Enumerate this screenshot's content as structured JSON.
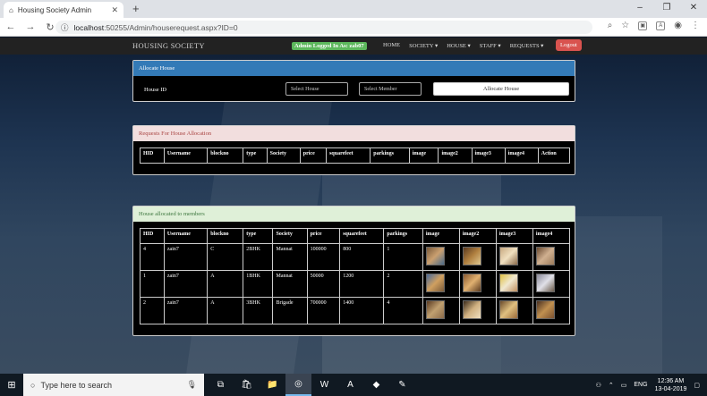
{
  "browser": {
    "tab_title": "Housing Society Admin",
    "url_host": "localhost",
    "url_rest": ":50255/Admin/houserequest.aspx?ID=0"
  },
  "navbar": {
    "brand": "HOUSING SOCIETY",
    "admin_badge": "Admin Logged In As: zab07",
    "menu": [
      "HOME",
      "SOCIETY ▾",
      "HOUSE ▾",
      "STAFF ▾",
      "REQUESTS ▾"
    ],
    "logout": "Logout"
  },
  "allocate": {
    "heading": "Allocate House",
    "house_id_label": "House ID",
    "select_house": "Select House",
    "select_member": "Select Member",
    "button": "Allocate House"
  },
  "requests": {
    "heading": "Requests For House Allocation",
    "columns": [
      "HID",
      "Username",
      "blockno",
      "type",
      "Society",
      "price",
      "squarefeet",
      "parkings",
      "image",
      "image2",
      "image3",
      "image4",
      "Action"
    ]
  },
  "allocated": {
    "heading": "House allocated to members",
    "columns": [
      "HID",
      "Username",
      "blockno",
      "type",
      "Society",
      "price",
      "squarefeet",
      "parkings",
      "image",
      "image2",
      "image3",
      "image4"
    ],
    "rows": [
      [
        "4",
        "zain7",
        "C",
        "2BHK",
        "Mannat",
        "100000",
        "800",
        "1"
      ],
      [
        "1",
        "zain7",
        "A",
        "1BHK",
        "Mannat",
        "50000",
        "1200",
        "2"
      ],
      [
        "2",
        "zain7",
        "A",
        "3BHK",
        "Brigade",
        "700000",
        "1400",
        "4"
      ]
    ]
  },
  "taskbar": {
    "search_placeholder": "Type here to search",
    "lang": "ENG",
    "time": "12:36 AM",
    "date": "13-04-2019"
  }
}
